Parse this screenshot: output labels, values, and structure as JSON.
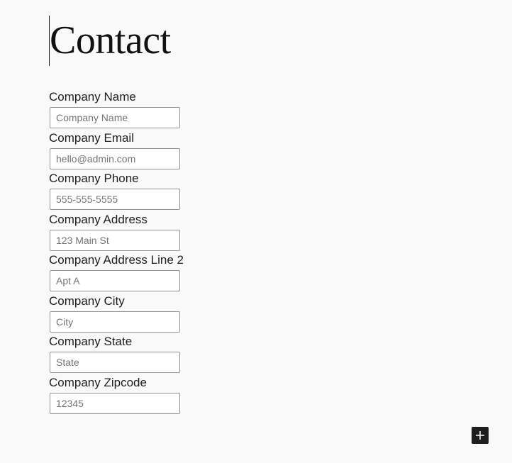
{
  "page": {
    "title": "Contact"
  },
  "form": {
    "fields": [
      {
        "label": "Company Name",
        "placeholder": "Company Name"
      },
      {
        "label": "Company Email",
        "placeholder": "hello@admin.com"
      },
      {
        "label": "Company Phone",
        "placeholder": "555-555-5555"
      },
      {
        "label": "Company Address",
        "placeholder": "123 Main St"
      },
      {
        "label": "Company Address Line 2",
        "placeholder": "Apt A"
      },
      {
        "label": "Company City",
        "placeholder": "City"
      },
      {
        "label": "Company State",
        "placeholder": "State"
      },
      {
        "label": "Company Zipcode",
        "placeholder": "12345"
      }
    ]
  },
  "toolbar": {
    "add_block_icon": "plus-icon"
  },
  "colors": {
    "background": "#f9f9f9",
    "text": "#1e1e1e",
    "input_border": "#949494",
    "placeholder": "#757575",
    "button_bg": "#1e1e1e",
    "button_icon": "#ffffff"
  }
}
